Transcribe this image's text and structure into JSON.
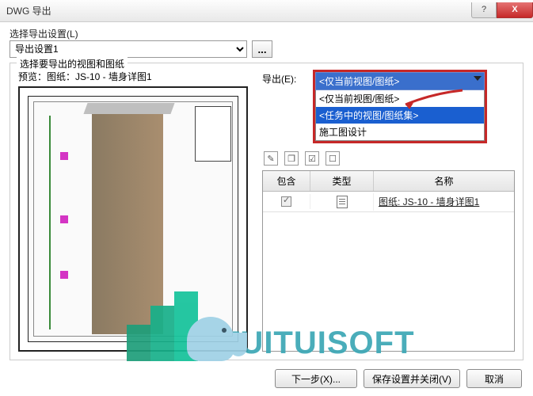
{
  "window": {
    "title": "DWG 导出",
    "help": "?",
    "close": "X"
  },
  "settings": {
    "label": "选择导出设置(L)",
    "value": "导出设置1",
    "dots": "..."
  },
  "group": {
    "title": "选择要导出的视图和图纸",
    "preview_label": "预览：图纸：JS-10 - 墙身详图1",
    "export_label": "导出(E):",
    "dropdown": {
      "selected": "<仅当前视图/图纸>",
      "options": [
        "<仅当前视图/图纸>",
        "<任务中的视图/图纸集>",
        "施工图设计"
      ]
    },
    "grid": {
      "headers": {
        "include": "包含",
        "type": "类型",
        "name": "名称"
      },
      "rows": [
        {
          "name": "图纸: JS-10 - 墙身详图1"
        }
      ]
    }
  },
  "footer": {
    "next": "下一步(X)...",
    "save_close": "保存设置并关闭(V)",
    "cancel": "取消"
  },
  "watermark": "TUITUISOFT"
}
